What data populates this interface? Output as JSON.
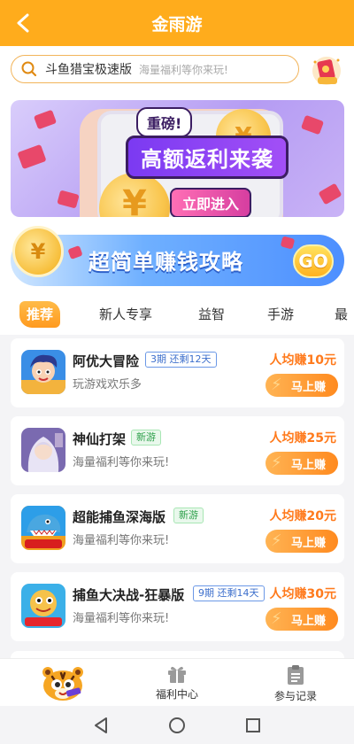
{
  "header": {
    "title": "金雨游"
  },
  "search": {
    "keyword": "斗鱼猎宝极速版",
    "placeholder": "海量福利等你来玩!"
  },
  "banner": {
    "tag": "重磅!",
    "headline": "高额返利来袭",
    "button": "立即进入"
  },
  "banner2": {
    "text": "超简单赚钱攻略",
    "go": "GO",
    "coin_symbol": "¥"
  },
  "tabs": [
    {
      "label": "推荐",
      "active": true
    },
    {
      "label": "新人专享"
    },
    {
      "label": "益智"
    },
    {
      "label": "手游"
    },
    {
      "label": "最"
    }
  ],
  "games": [
    {
      "name": "阿优大冒险",
      "badge_type": "period",
      "badge_period": "3期",
      "badge_remain": "还剩12天",
      "desc": "玩游戏欢乐多",
      "reward": "人均赚10元",
      "button": "马上赚",
      "icon": "cartoon-boy-game-icon"
    },
    {
      "name": "神仙打架",
      "badge_type": "new",
      "badge": "新游",
      "desc": "海量福利等你来玩!",
      "reward": "人均赚25元",
      "button": "马上赚",
      "icon": "fairy-girl-game-icon"
    },
    {
      "name": "超能捕鱼深海版",
      "badge_type": "new",
      "badge": "新游",
      "desc": "海量福利等你来玩!",
      "reward": "人均赚20元",
      "button": "马上赚",
      "icon": "shark-hot-game-icon"
    },
    {
      "name": "捕鱼大决战-狂暴版",
      "badge_type": "period",
      "badge_period": "9期",
      "badge_remain": "还剩14天",
      "desc": "海量福利等你来玩!",
      "reward": "人均赚30元",
      "button": "马上赚",
      "icon": "fish-battle-game-icon"
    }
  ],
  "nav": {
    "items": [
      {
        "label": "",
        "icon": "tiger-mascot-icon"
      },
      {
        "label": "福利中心",
        "icon": "gift-icon"
      },
      {
        "label": "参与记录",
        "icon": "clipboard-icon"
      }
    ]
  },
  "colors": {
    "header": "#ffac1c",
    "accent": "#ff7a1c",
    "search_border": "#f2b45a"
  }
}
